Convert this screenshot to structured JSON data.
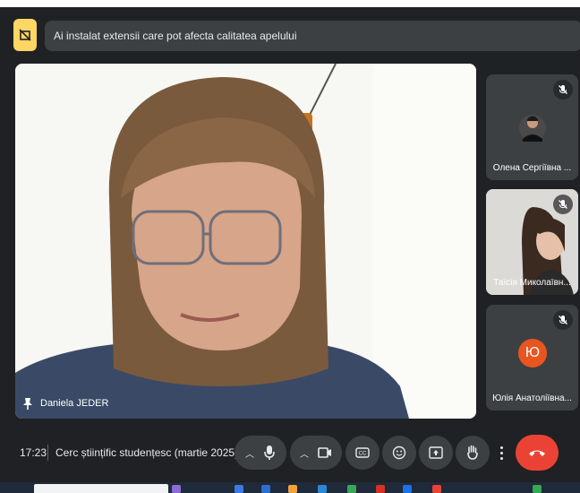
{
  "banner": {
    "text": "Ai instalat extensii care pot afecta calitatea apelului"
  },
  "main_participant": {
    "name": "Daniela JEDER"
  },
  "side_participants": [
    {
      "name": "Олена Сергіївна ...",
      "avatar_initial": ""
    },
    {
      "name": "Таїсія Миколаївн...",
      "avatar_initial": ""
    },
    {
      "name": "Юлія Анатоліївна...",
      "avatar_initial": "Ю"
    }
  ],
  "bottom_bar": {
    "time": "17:23",
    "meeting_title": "Cerc științific studențesc (martie 2025)"
  },
  "colors": {
    "background": "#202124",
    "banner_bg": "#3c4043",
    "extension_icon_bg": "#fdd663",
    "hangup": "#ea4335",
    "avatar_orange": "#e8551f"
  },
  "icons": [
    "extension-warning-icon",
    "pin-icon",
    "mic-muted-icon",
    "mic-icon",
    "camera-icon",
    "captions-icon",
    "emoji-icon",
    "present-icon",
    "raise-hand-icon",
    "more-options-icon",
    "hangup-icon"
  ]
}
